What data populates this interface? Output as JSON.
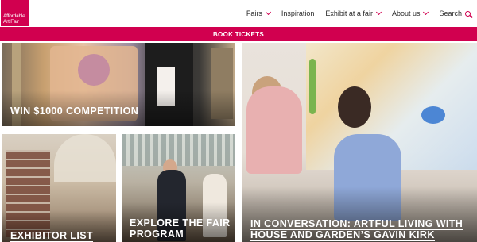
{
  "brand": {
    "logo_lines": [
      "Affordable",
      "Art Fair"
    ],
    "accent": "#d1004f"
  },
  "nav": {
    "items": [
      {
        "label": "Fairs",
        "dropdown": true
      },
      {
        "label": "Inspiration",
        "dropdown": false
      },
      {
        "label": "Exhibit at a fair",
        "dropdown": true
      },
      {
        "label": "About us",
        "dropdown": true
      }
    ],
    "search_label": "Search"
  },
  "ticket_bar": {
    "label": "BOOK TICKETS"
  },
  "tiles": {
    "competition": {
      "caption": "WIN $1000 COMPETITION"
    },
    "conversation": {
      "caption_line1": "IN CONVERSATION: ARTFUL LIVING WITH",
      "caption_line2": "HOUSE AND GARDEN’S GAVIN KIRK"
    },
    "exhibitor": {
      "caption": "EXHIBITOR LIST"
    },
    "explore": {
      "caption_line1": "EXPLORE THE FAIR",
      "caption_line2": "PROGRAM"
    }
  }
}
